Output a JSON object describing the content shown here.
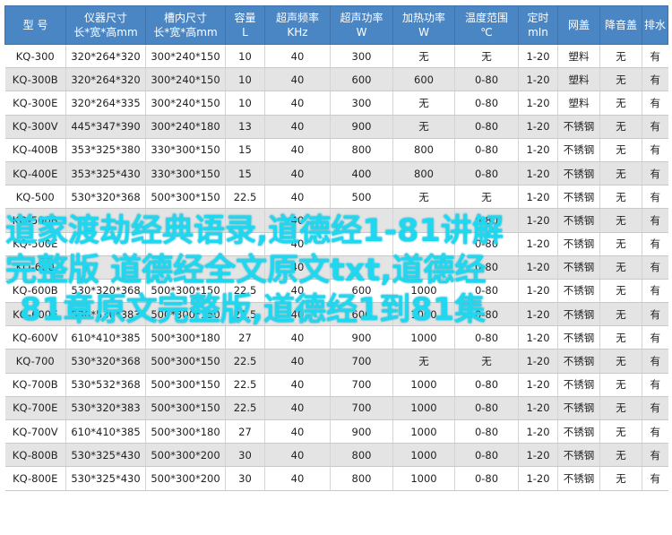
{
  "headers": [
    {
      "line1": "型 号",
      "line2": ""
    },
    {
      "line1": "仪器尺寸",
      "line2": "长*宽*高mm"
    },
    {
      "line1": "槽内尺寸",
      "line2": "长*宽*高mm"
    },
    {
      "line1": "容量",
      "line2": "L"
    },
    {
      "line1": "超声频率",
      "line2": "KHz"
    },
    {
      "line1": "超声功率",
      "line2": "W"
    },
    {
      "line1": "加热功率",
      "line2": "W"
    },
    {
      "line1": "温度范围",
      "line2": "℃"
    },
    {
      "line1": "定时",
      "line2": "mIn"
    },
    {
      "line1": "网盖",
      "line2": ""
    },
    {
      "line1": "降音盖",
      "line2": ""
    },
    {
      "line1": "排水",
      "line2": ""
    }
  ],
  "rows": [
    [
      "KQ-300",
      "320*264*320",
      "300*240*150",
      "10",
      "40",
      "300",
      "无",
      "无",
      "1-20",
      "塑料",
      "无",
      "有"
    ],
    [
      "KQ-300B",
      "320*264*320",
      "300*240*150",
      "10",
      "40",
      "600",
      "600",
      "0-80",
      "1-20",
      "塑料",
      "无",
      "有"
    ],
    [
      "KQ-300E",
      "320*264*335",
      "300*240*150",
      "10",
      "40",
      "300",
      "无",
      "0-80",
      "1-20",
      "塑料",
      "无",
      "有"
    ],
    [
      "KQ-300V",
      "445*347*390",
      "300*240*180",
      "13",
      "40",
      "900",
      "无",
      "0-80",
      "1-20",
      "不锈钢",
      "无",
      "有"
    ],
    [
      "KQ-400B",
      "353*325*380",
      "330*300*150",
      "15",
      "40",
      "800",
      "800",
      "0-80",
      "1-20",
      "不锈钢",
      "无",
      "有"
    ],
    [
      "KQ-400E",
      "353*325*430",
      "330*300*150",
      "15",
      "40",
      "400",
      "800",
      "0-80",
      "1-20",
      "不锈钢",
      "无",
      "有"
    ],
    [
      "KQ-500",
      "530*320*368",
      "500*300*150",
      "22.5",
      "40",
      "500",
      "无",
      "无",
      "1-20",
      "不锈钢",
      "无",
      "有"
    ],
    [
      "KQ-500B",
      "",
      "",
      "",
      "40",
      "",
      "",
      "0-80",
      "1-20",
      "不锈钢",
      "无",
      "有"
    ],
    [
      "KQ-500E",
      "",
      "",
      "",
      "40",
      "",
      "",
      "0-80",
      "1-20",
      "不锈钢",
      "无",
      "有"
    ],
    [
      "KQ-600",
      "",
      "",
      "",
      "40",
      "",
      "",
      "0-80",
      "1-20",
      "不锈钢",
      "无",
      "有"
    ],
    [
      "KQ-600B",
      "530*320*368",
      "500*300*150",
      "22.5",
      "40",
      "600",
      "1000",
      "0-80",
      "1-20",
      "不锈钢",
      "无",
      "有"
    ],
    [
      "KQ-600E",
      "530*530*383",
      "500*300*150",
      "22.5",
      "40",
      "600",
      "1000",
      "0-80",
      "1-20",
      "不锈钢",
      "无",
      "有"
    ],
    [
      "KQ-600V",
      "610*410*385",
      "500*300*180",
      "27",
      "40",
      "900",
      "1000",
      "0-80",
      "1-20",
      "不锈钢",
      "无",
      "有"
    ],
    [
      "KQ-700",
      "530*320*368",
      "500*300*150",
      "22.5",
      "40",
      "700",
      "无",
      "无",
      "1-20",
      "不锈钢",
      "无",
      "有"
    ],
    [
      "KQ-700B",
      "530*532*368",
      "500*300*150",
      "22.5",
      "40",
      "700",
      "1000",
      "0-80",
      "1-20",
      "不锈钢",
      "无",
      "有"
    ],
    [
      "KQ-700E",
      "530*320*383",
      "500*300*150",
      "22.5",
      "40",
      "700",
      "1000",
      "0-80",
      "1-20",
      "不锈钢",
      "无",
      "有"
    ],
    [
      "KQ-700V",
      "610*410*385",
      "500*300*180",
      "27",
      "40",
      "900",
      "1000",
      "0-80",
      "1-20",
      "不锈钢",
      "无",
      "有"
    ],
    [
      "KQ-800B",
      "530*325*430",
      "500*300*200",
      "30",
      "40",
      "800",
      "1000",
      "0-80",
      "1-20",
      "不锈钢",
      "无",
      "有"
    ],
    [
      "KQ-800E",
      "530*325*430",
      "500*300*200",
      "30",
      "40",
      "800",
      "1000",
      "0-80",
      "1-20",
      "不锈钢",
      "无",
      "有"
    ]
  ],
  "overlay_text": [
    "道家渡劫经典语录,道德经1-81讲解",
    "完整版 道德经全文原文txt,道德经",
    "81章原文完整版,道德经1到81集"
  ],
  "colors": {
    "header_bg": "#4a85c4",
    "header_text": "#ffffff",
    "row_alt_bg": "#e4e4e4",
    "overlay_text": "#1fd8f0"
  }
}
